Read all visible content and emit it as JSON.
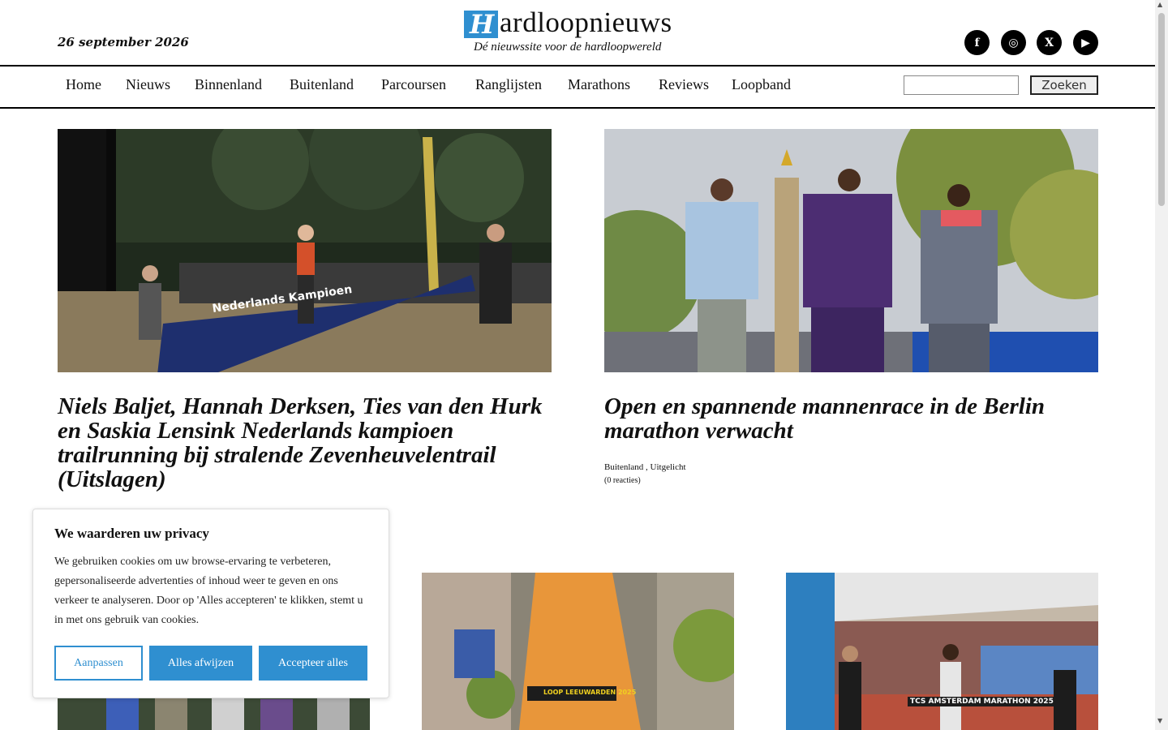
{
  "header": {
    "date": "26 september 2026",
    "logo_letter": "H",
    "logo_text": "ardloopnieuws",
    "tagline": "Dé nieuwssite voor de hardloopwereld",
    "social": [
      {
        "name": "facebook-icon",
        "glyph": "f"
      },
      {
        "name": "instagram-icon",
        "glyph": "◎"
      },
      {
        "name": "x-icon",
        "glyph": "X"
      },
      {
        "name": "youtube-icon",
        "glyph": "▶"
      }
    ]
  },
  "nav": {
    "items": [
      "Home",
      "Nieuws",
      "Binnenland",
      "Buitenland",
      "Parcoursen",
      "Ranglijsten",
      "Marathons",
      "Reviews",
      "Loopband"
    ],
    "search_placeholder": "",
    "search_button": "Zoeken"
  },
  "articles": [
    {
      "title": "Niels Baljet, Hannah Derksen, Ties van den Hurk en Saskia Lensink Nederlands kampioen trailrunning bij stralende Zevenheuvelentrail (Uitslagen)",
      "banner_text": "Nederlands Kampioen"
    },
    {
      "title": "Open en spannende mannenrace in de Berlin marathon verwacht",
      "categories": "Buitenland , Uitgelicht",
      "comments": "(0 reacties)"
    },
    {
      "banner_text": "LOOP LEEUWARDEN 2025"
    },
    {
      "banner_text": "TCS AMSTERDAM MARATHON 2025"
    }
  ],
  "cookie": {
    "title": "We waarderen uw privacy",
    "text": "We gebruiken cookies om uw browse-ervaring te verbeteren, gepersonaliseerde advertenties of inhoud weer te geven en ons verkeer te analyseren. Door op 'Alles accepteren' te klikken, stemt u in met ons gebruik van cookies.",
    "btn_customize": "Aanpassen",
    "btn_reject": "Alles afwijzen",
    "btn_accept": "Accepteer alles"
  },
  "colors": {
    "accent": "#2f8fd0"
  }
}
